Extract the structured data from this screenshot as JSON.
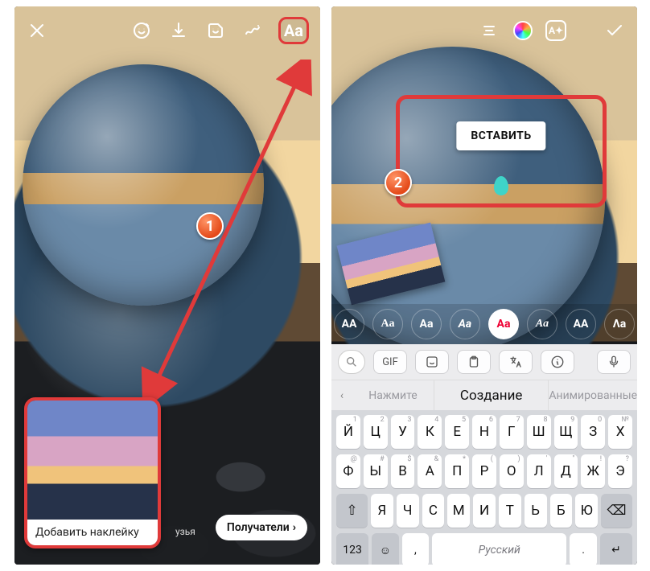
{
  "left": {
    "aa": "Aa",
    "sticker_label": "Добавить наклейку",
    "friends": "узья",
    "recipients": "Получатели",
    "badge": "1"
  },
  "right": {
    "astar": "A✦",
    "paste": "ВСТАВИТЬ",
    "badge": "2",
    "fonts": [
      "AA",
      "Aa",
      "Aa",
      "Aa",
      "Aa",
      "Aa",
      "AA",
      "Λа"
    ],
    "kbdtool_gif": "GIF",
    "suggest_left": "Нажмите",
    "suggest_center": "Создание",
    "suggest_right": "Анимированные",
    "row1_main": [
      "Й",
      "Ц",
      "У",
      "К",
      "Е",
      "Н",
      "Г",
      "Ш",
      "Щ",
      "З",
      "Х"
    ],
    "row1_hint": [
      "1",
      "2",
      "3",
      "4",
      "5",
      "6",
      "7",
      "8",
      "9",
      "0",
      "№"
    ],
    "row2_main": [
      "Ф",
      "Ы",
      "В",
      "А",
      "П",
      "Р",
      "О",
      "Л",
      "Д",
      "Ж",
      "Э"
    ],
    "row2_hint": [
      "@",
      "#",
      "$",
      "&",
      "*",
      "(",
      ")",
      "'",
      "\"",
      "!",
      "?"
    ],
    "row3_main": [
      "Я",
      "Ч",
      "С",
      "М",
      "И",
      "Т",
      "Ь",
      "Б",
      "Ю"
    ],
    "shift": "⇧",
    "bksp": "⌫",
    "r5_123": "123",
    "r5_emoji": "☺",
    "r5_comma": ",",
    "r5_space": "Русский",
    "r5_dot": ".",
    "r5_enter": "↵"
  }
}
